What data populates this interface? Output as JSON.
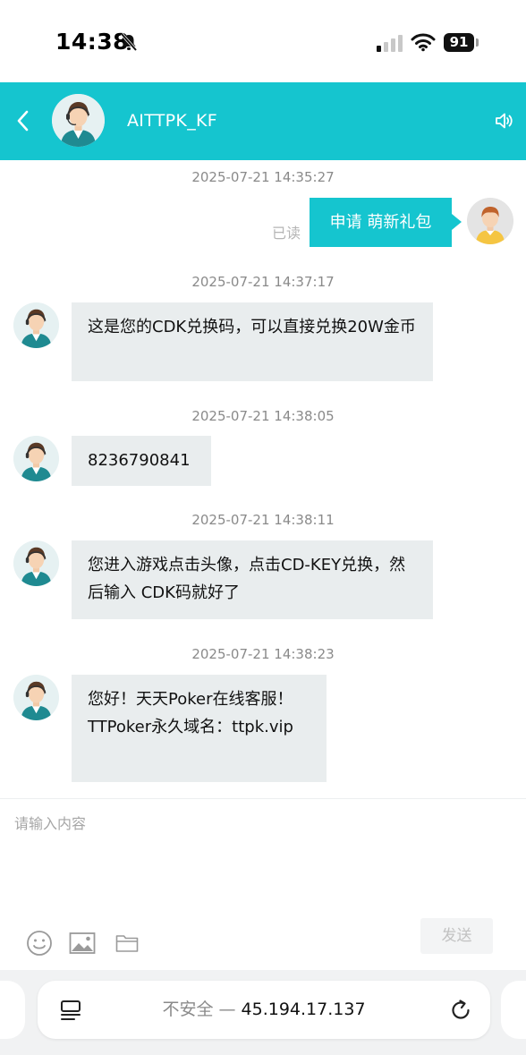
{
  "status_bar": {
    "time": "14:38",
    "battery": "91"
  },
  "header": {
    "title": "AITTPK_KF"
  },
  "chat": {
    "messages": [
      {
        "timestamp": "2025-07-21 14:35:27",
        "from": "user",
        "text": "申请 萌新礼包",
        "read_label": "已读"
      },
      {
        "timestamp": "2025-07-21 14:37:17",
        "from": "agent",
        "text": "这是您的CDK兑换码，可以直接兑换20W金币"
      },
      {
        "timestamp": "2025-07-21 14:38:05",
        "from": "agent",
        "text": "8236790841"
      },
      {
        "timestamp": "2025-07-21 14:38:11",
        "from": "agent",
        "text": "您进入游戏点击头像，点击CD-KEY兑换，然后输入 CDK码就好了"
      },
      {
        "timestamp": "2025-07-21 14:38:23",
        "from": "agent",
        "text_lines": [
          "您好！天天Poker在线客服！",
          "TTPoker永久域名：ttpk.vip"
        ]
      }
    ]
  },
  "input": {
    "placeholder": "请输入内容",
    "send_label": "发送"
  },
  "browser": {
    "insecure_label": "不安全 —",
    "address": "45.194.17.137"
  },
  "colors": {
    "accent": "#15c5cf",
    "bubble_bg": "#e9edee"
  }
}
